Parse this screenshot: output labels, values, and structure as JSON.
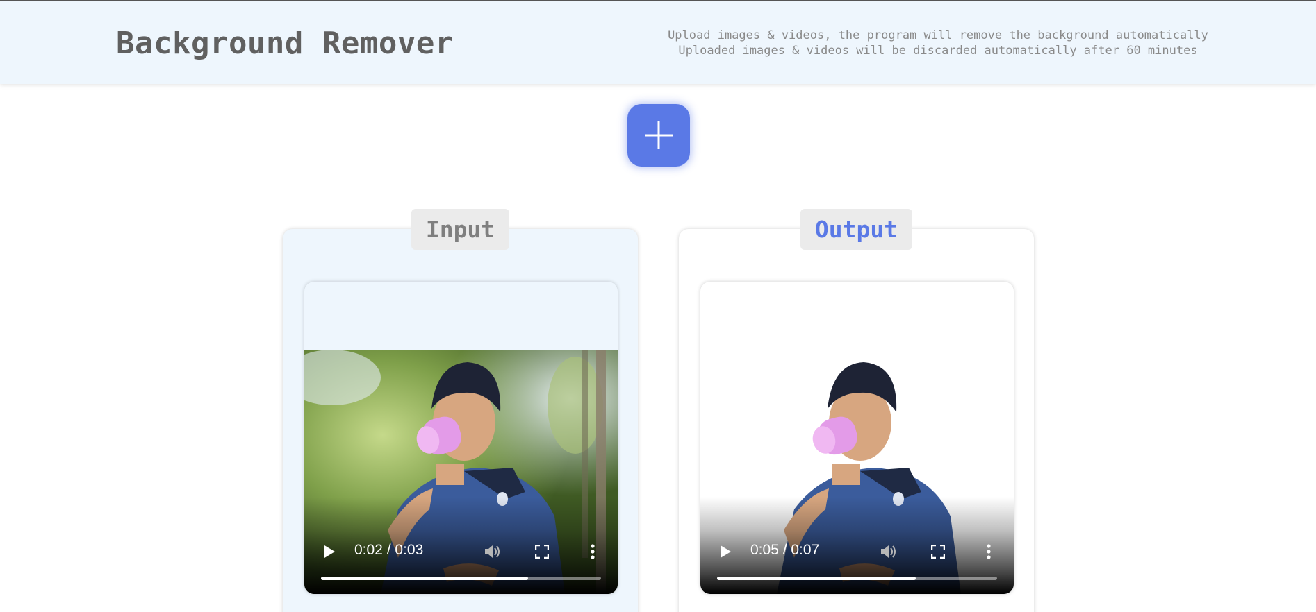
{
  "header": {
    "title": "Background Remover",
    "subtitle_line1": "Upload images & videos, the program will remove the background automatically",
    "subtitle_line2": "Uploaded images & videos will be discarded automatically after 60 minutes"
  },
  "add_button": {
    "icon": "plus-icon",
    "color": "#5a79e6"
  },
  "panels": {
    "input": {
      "label": "Input",
      "video": {
        "time": "0:02 / 0:03",
        "progress": 0.74
      }
    },
    "output": {
      "label": "Output",
      "video": {
        "time": "0:05 / 0:07",
        "progress": 0.71
      }
    }
  },
  "video_controls": [
    "play-icon",
    "volume-icon",
    "fullscreen-icon",
    "more-vert-icon"
  ],
  "colors": {
    "accent": "#5a79e6",
    "header_bg": "#eef6fd",
    "title": "#606060"
  }
}
